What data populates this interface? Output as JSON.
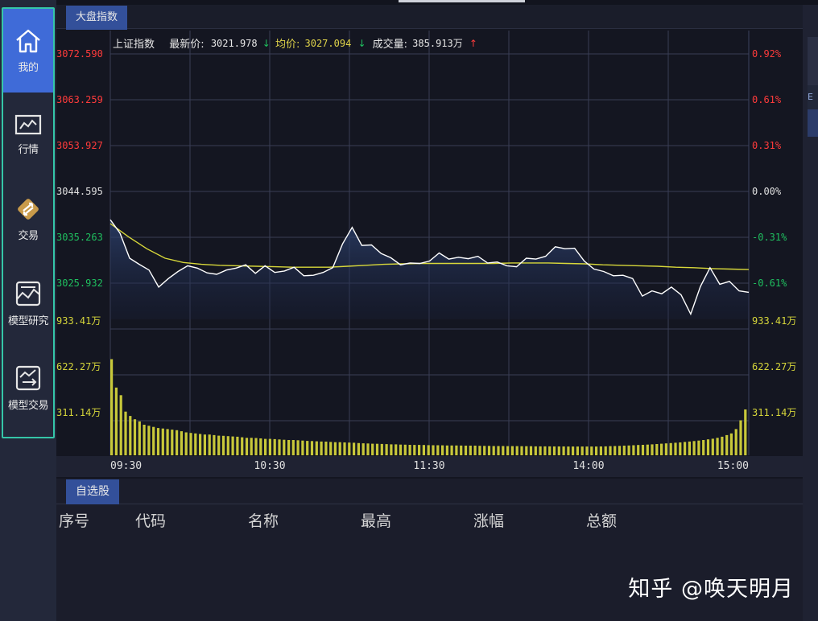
{
  "sidebar": {
    "items": [
      {
        "label": "我的",
        "icon": "home-icon",
        "active": true
      },
      {
        "label": "行情",
        "icon": "market-chart-icon",
        "active": false
      },
      {
        "label": "交易",
        "icon": "trade-exchange-icon",
        "active": false
      },
      {
        "label": "模型研究",
        "icon": "model-research-icon",
        "active": false
      },
      {
        "label": "模型交易",
        "icon": "model-trade-icon",
        "active": false
      }
    ]
  },
  "chart_panel": {
    "tab_label": "大盘指数",
    "info": {
      "index_name": "上证指数",
      "latest_label": "最新价:",
      "latest_value": "3021.978",
      "latest_arrow": "down",
      "avg_label": "均价:",
      "avg_value": "3027.094",
      "avg_arrow": "down",
      "volume_label": "成交量:",
      "volume_value": "385.913万",
      "volume_arrow": "up"
    },
    "colors": {
      "up": "#ff3b3b",
      "down": "#1fbf5f",
      "neutral": "#e0e0e0",
      "avg_line": "#d8d83a",
      "price_line": "#ffffff",
      "volume_bar": "#c8c83a",
      "grid": "#3a3e55"
    }
  },
  "chart_data": {
    "type": "line",
    "price_ticks_left": [
      "3072.590",
      "3063.259",
      "3053.927",
      "3044.595",
      "3035.263",
      "3025.932"
    ],
    "price_ticks_right": [
      "0.92%",
      "0.61%",
      "0.31%",
      "0.00%",
      "-0.31%",
      "-0.61%"
    ],
    "volume_ticks_left": [
      "933.41万",
      "622.27万",
      "311.14万"
    ],
    "volume_ticks_right": [
      "933.41万",
      "622.27万",
      "311.14万"
    ],
    "x_ticks": [
      "09:30",
      "10:30",
      "11:30",
      "14:00",
      "15:00"
    ],
    "price_ylim": [
      3016.6,
      3072.59
    ],
    "volume_ylim": [
      0,
      1244.5
    ],
    "series": [
      {
        "role": "price",
        "values": [
          3037.6,
          3034.8,
          3029.5,
          3028.2,
          3027.0,
          3023.4,
          3025.2,
          3026.7,
          3027.9,
          3027.4,
          3026.4,
          3026.1,
          3027.0,
          3027.4,
          3028.1,
          3026.3,
          3027.9,
          3026.5,
          3026.8,
          3027.6,
          3025.8,
          3025.9,
          3026.5,
          3027.5,
          3032.5,
          3036.0,
          3032.2,
          3032.3,
          3030.5,
          3029.6,
          3028.1,
          3028.5,
          3028.4,
          3028.9,
          3030.6,
          3029.3,
          3029.7,
          3029.4,
          3029.9,
          3028.5,
          3028.7,
          3027.9,
          3027.7,
          3029.5,
          3029.3,
          3029.9,
          3031.9,
          3031.5,
          3031.6,
          3028.9,
          3027.2,
          3026.7,
          3025.8,
          3025.9,
          3025.2,
          3021.5,
          3022.6,
          3022.0,
          3023.4,
          3021.8,
          3017.7,
          3023.5,
          3027.5,
          3024.0,
          3024.6,
          3022.6,
          3022.3
        ]
      },
      {
        "role": "average",
        "values": [
          3036.8,
          3034.0,
          3031.5,
          3029.5,
          3028.6,
          3028.2,
          3028.0,
          3027.9,
          3027.8,
          3027.7,
          3027.6,
          3027.6,
          3027.6,
          3027.8,
          3028.0,
          3028.2,
          3028.3,
          3028.4,
          3028.4,
          3028.4,
          3028.4,
          3028.4,
          3028.5,
          3028.5,
          3028.5,
          3028.4,
          3028.3,
          3028.1,
          3028.0,
          3027.9,
          3027.8,
          3027.6,
          3027.5,
          3027.3,
          3027.2,
          3027.1
        ]
      },
      {
        "role": "volume",
        "values": [
          880,
          620,
          550,
          400,
          360,
          330,
          310,
          280,
          270,
          260,
          250,
          245,
          240,
          235,
          230,
          220,
          210,
          205,
          200,
          195,
          190,
          190,
          185,
          180,
          178,
          175,
          172,
          170,
          165,
          160,
          160,
          158,
          155,
          150,
          150,
          148,
          145,
          142,
          140,
          140,
          138,
          135,
          132,
          130,
          128,
          126,
          125,
          122,
          120,
          120,
          118,
          116,
          115,
          112,
          110,
          108,
          106,
          105,
          104,
          102,
          100,
          100,
          98,
          97,
          96,
          95,
          95,
          94,
          93,
          92,
          92,
          91,
          90,
          90,
          90,
          89,
          88,
          88,
          88,
          87,
          86,
          86,
          85,
          85,
          85,
          84,
          84,
          84,
          83,
          83,
          83,
          82,
          82,
          82,
          82,
          81,
          81,
          81,
          80,
          80,
          80,
          80,
          80,
          80,
          80,
          81,
          82,
          84,
          85,
          86,
          88,
          90,
          92,
          94,
          96,
          98,
          100,
          103,
          106,
          109,
          112,
          115,
          118,
          122,
          126,
          130,
          135,
          140,
          146,
          152,
          160,
          170,
          185,
          200,
          240,
          320,
          420
        ]
      }
    ]
  },
  "watchlist": {
    "tab_label": "自选股",
    "columns": [
      "序号",
      "代码",
      "名称",
      "最高",
      "涨幅",
      "总额"
    ]
  },
  "right_edge": {
    "label": "E"
  },
  "watermark": "知乎 @唤天明月"
}
